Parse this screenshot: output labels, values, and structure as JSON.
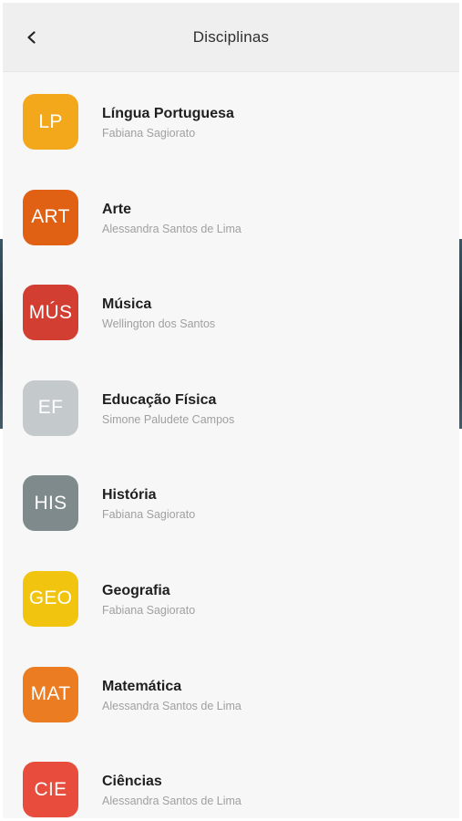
{
  "header": {
    "title": "Disciplinas",
    "back_icon": "chevron-left-icon"
  },
  "subjects": [
    {
      "abbr": "LP",
      "name": "Língua Portuguesa",
      "teacher": "Fabiana Sagiorato",
      "color": "#F3A71B"
    },
    {
      "abbr": "ART",
      "name": "Arte",
      "teacher": "Alessandra Santos de Lima",
      "color": "#E06014"
    },
    {
      "abbr": "MÚS",
      "name": "Música",
      "teacher": "Wellington dos Santos",
      "color": "#D23E32"
    },
    {
      "abbr": "EF",
      "name": "Educação Física",
      "teacher": "Simone Paludete Campos",
      "color": "#C4C9CC"
    },
    {
      "abbr": "HIS",
      "name": "História",
      "teacher": "Fabiana Sagiorato",
      "color": "#7E8A8C"
    },
    {
      "abbr": "GEO",
      "name": "Geografia",
      "teacher": "Fabiana Sagiorato",
      "color": "#F1C40F"
    },
    {
      "abbr": "MAT",
      "name": "Matemática",
      "teacher": "Alessandra Santos de Lima",
      "color": "#EB7C22"
    },
    {
      "abbr": "CIE",
      "name": "Ciências",
      "teacher": "Alessandra Santos de Lima",
      "color": "#E74C3C"
    }
  ]
}
